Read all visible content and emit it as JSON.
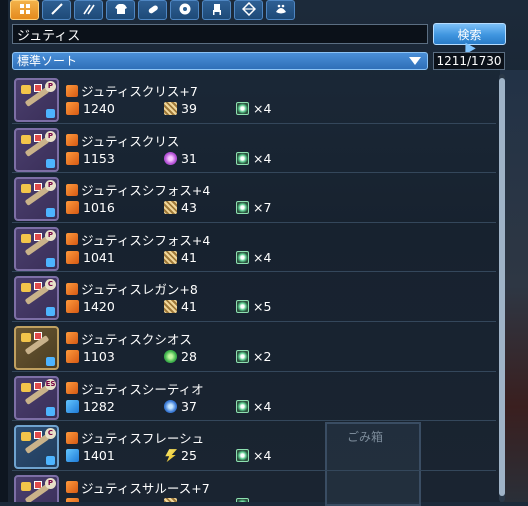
{
  "tabs": [
    {
      "icon": "grid-icon",
      "active": true
    },
    {
      "icon": "sword-icon",
      "active": false
    },
    {
      "icon": "dual-blades-icon",
      "active": false
    },
    {
      "icon": "shirt-icon",
      "active": false
    },
    {
      "icon": "capsule-icon",
      "active": false
    },
    {
      "icon": "disc-icon",
      "active": false
    },
    {
      "icon": "furniture-icon",
      "active": false
    },
    {
      "icon": "diamond-icon",
      "active": false
    },
    {
      "icon": "pet-icon",
      "active": false
    }
  ],
  "search": {
    "value": "ジュティス",
    "button_label": "検索"
  },
  "sort": {
    "label": "標準ソート",
    "count": "1211/1730"
  },
  "background": {
    "box_label": "ごみ箱"
  },
  "items": [
    {
      "name": "ジュティスクリス+7",
      "attack": "1240",
      "element": "39",
      "slots": "×4",
      "frame": "purple",
      "badge": "P",
      "atk_color": "orange",
      "elem_style": "stripe"
    },
    {
      "name": "ジュティスクリス",
      "attack": "1153",
      "element": "31",
      "slots": "×4",
      "frame": "purple",
      "badge": "P",
      "atk_color": "orange",
      "elem_style": "purple"
    },
    {
      "name": "ジュティスシフォス+4",
      "attack": "1016",
      "element": "43",
      "slots": "×7",
      "frame": "purple",
      "badge": "P",
      "atk_color": "orange",
      "elem_style": "stripe"
    },
    {
      "name": "ジュティスシフォス+4",
      "attack": "1041",
      "element": "41",
      "slots": "×4",
      "frame": "purple",
      "badge": "P",
      "atk_color": "orange",
      "elem_style": "stripe"
    },
    {
      "name": "ジュティスレガン+8",
      "attack": "1420",
      "element": "41",
      "slots": "×5",
      "frame": "purple",
      "badge": "C",
      "atk_color": "orange",
      "elem_style": "stripe"
    },
    {
      "name": "ジュティスクシオス",
      "attack": "1103",
      "element": "28",
      "slots": "×2",
      "frame": "gold",
      "badge": "",
      "atk_color": "orange",
      "elem_style": "green"
    },
    {
      "name": "ジュティスシーティオ",
      "attack": "1282",
      "element": "37",
      "slots": "×4",
      "frame": "purple",
      "badge": "ES",
      "atk_color": "blue",
      "elem_style": "blue"
    },
    {
      "name": "ジュティスフレーシュ",
      "attack": "1401",
      "element": "25",
      "slots": "×4",
      "frame": "blue",
      "badge": "C",
      "atk_color": "blue",
      "elem_style": "yellow"
    },
    {
      "name": "ジュティスサルース+7",
      "attack": "",
      "element": "",
      "slots": "",
      "frame": "purple",
      "badge": "P",
      "atk_color": "orange",
      "elem_style": "stripe"
    }
  ]
}
